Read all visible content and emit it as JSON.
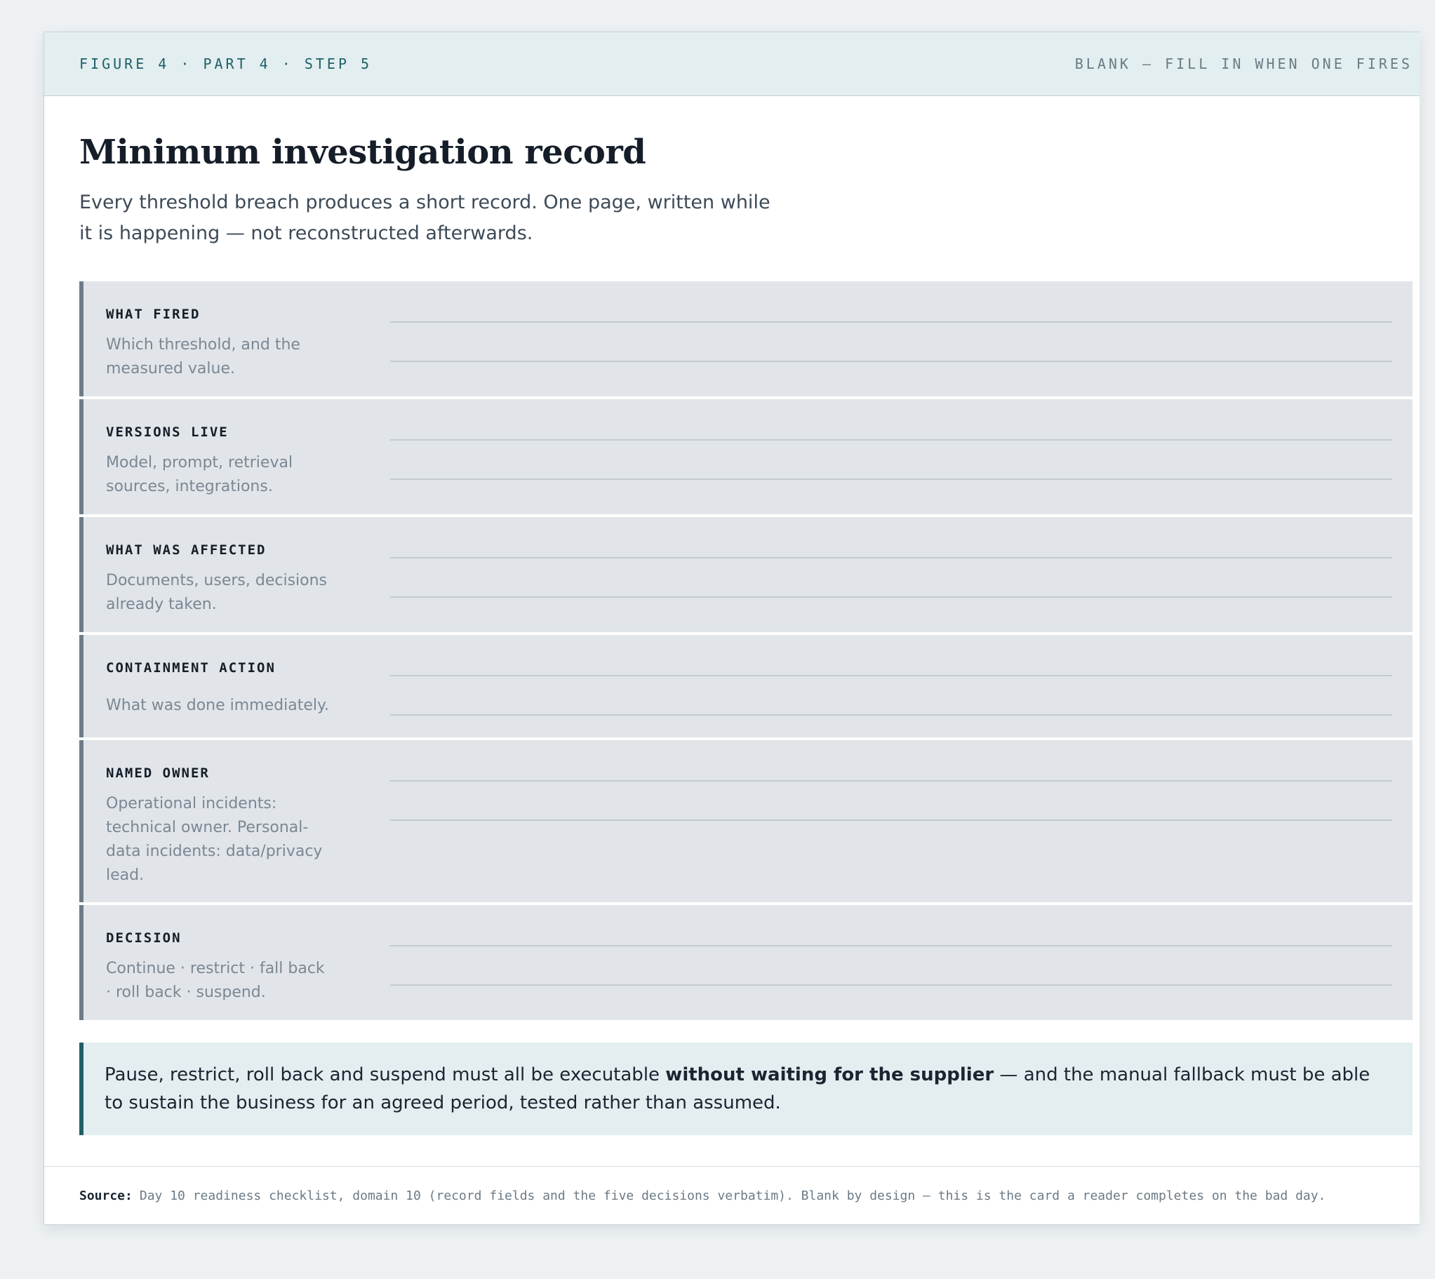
{
  "header": {
    "figure_label": "FIGURE 4 · PART 4 · STEP 5",
    "blank_label": "BLANK — FILL IN WHEN ONE FIRES"
  },
  "title": "Minimum investigation record",
  "intro": "Every threshold breach produces a short record. One page, written while it is happening — not reconstructed afterwards.",
  "fields": [
    {
      "name": "WHAT FIRED",
      "hint": "Which threshold, and the measured value."
    },
    {
      "name": "VERSIONS LIVE",
      "hint": "Model, prompt, retrieval sources, integrations."
    },
    {
      "name": "WHAT WAS AFFECTED",
      "hint": "Documents, users, decisions already taken."
    },
    {
      "name": "CONTAINMENT ACTION",
      "hint": "What was done immediately."
    },
    {
      "name": "NAMED OWNER",
      "hint": "Operational incidents: technical owner. Personal-data incidents: data/privacy lead."
    },
    {
      "name": "DECISION",
      "hint": "Continue · restrict · fall back · roll back · suspend."
    }
  ],
  "note": {
    "before": "Pause, restrict, roll back and suspend must all be executable ",
    "emphasis": "without waiting for the supplier",
    "after": " — and the manual fallback must be able to sustain the business for an agreed period, tested rather than assumed."
  },
  "footer": {
    "source_label": "Source:",
    "source_text": "Day 10 readiness checklist, domain 10 (record fields and the five decisions verbatim). Blank by design — this is the card a reader completes on the bad day."
  },
  "colors": {
    "accent": "#1f5f66",
    "row_background": "#e1e5e9",
    "row_rule": "#6f7b87",
    "header_background": "#e2eef0"
  }
}
